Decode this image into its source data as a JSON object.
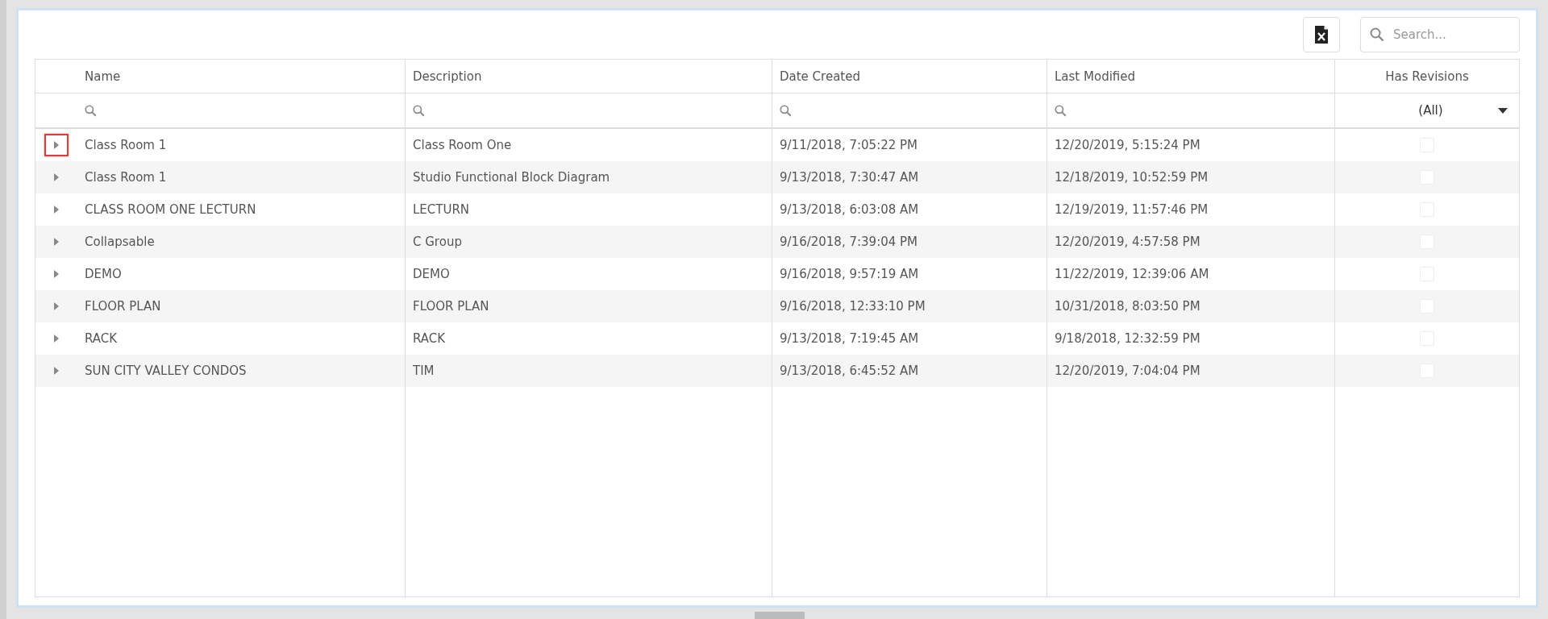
{
  "toolbar": {
    "search": {
      "placeholder": "Search..."
    }
  },
  "table": {
    "columns": [
      "Name",
      "Description",
      "Date Created",
      "Last Modified",
      "Has Revisions"
    ],
    "filter": {
      "value": "(All)"
    },
    "rows": [
      {
        "name": "Class Room 1",
        "description": "Class Room One",
        "created": "9/11/2018, 7:05:22 PM",
        "modified": "12/20/2019, 5:15:24 PM",
        "has_revisions": false,
        "highlighted": true
      },
      {
        "name": "Class Room 1",
        "description": "Studio Functional Block Diagram",
        "created": "9/13/2018, 7:30:47 AM",
        "modified": "12/18/2019, 10:52:59 PM",
        "has_revisions": false,
        "highlighted": false
      },
      {
        "name": "CLASS ROOM ONE LECTURN",
        "description": "LECTURN",
        "created": "9/13/2018, 6:03:08 AM",
        "modified": "12/19/2019, 11:57:46 PM",
        "has_revisions": false,
        "highlighted": false
      },
      {
        "name": "Collapsable",
        "description": "C Group",
        "created": "9/16/2018, 7:39:04 PM",
        "modified": "12/20/2019, 4:57:58 PM",
        "has_revisions": false,
        "highlighted": false
      },
      {
        "name": "DEMO",
        "description": "DEMO",
        "created": "9/16/2018, 9:57:19 AM",
        "modified": "11/22/2019, 12:39:06 AM",
        "has_revisions": false,
        "highlighted": false
      },
      {
        "name": "FLOOR PLAN",
        "description": "FLOOR PLAN",
        "created": "9/16/2018, 12:33:10 PM",
        "modified": "10/31/2018, 8:03:50 PM",
        "has_revisions": false,
        "highlighted": false
      },
      {
        "name": "RACK",
        "description": "RACK",
        "created": "9/13/2018, 7:19:45 AM",
        "modified": "9/18/2018, 12:32:59 PM",
        "has_revisions": false,
        "highlighted": false
      },
      {
        "name": "SUN CITY VALLEY CONDOS",
        "description": "TIM",
        "created": "9/13/2018, 6:45:52 AM",
        "modified": "12/20/2019, 7:04:04 PM",
        "has_revisions": false,
        "highlighted": false
      }
    ]
  }
}
